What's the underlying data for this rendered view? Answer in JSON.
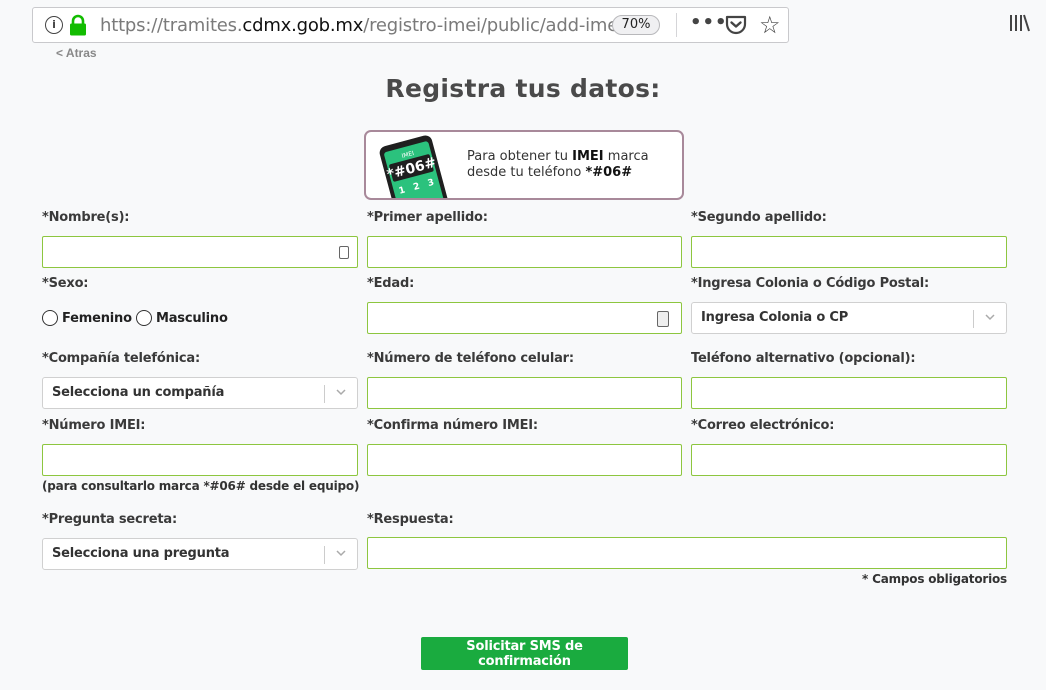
{
  "browser": {
    "url_prefix": "https://tramites.",
    "url_host": "cdmx.gob.mx",
    "url_path": "/registro-imei/public/add-imei",
    "zoom": "70%"
  },
  "page": {
    "back_link": "< Atras",
    "title": "Registra tus datos:"
  },
  "banner": {
    "phone_screen_label": "IMEI",
    "phone_screen_code": "*#06#",
    "keypad": [
      "1",
      "2",
      "3"
    ],
    "text_part1": "Para obtener tu ",
    "text_bold1": "IMEI",
    "text_part2": " marca",
    "text_line2": "desde tu teléfono ",
    "text_bold2": "*#06#"
  },
  "form": {
    "nombre_label": "*Nombre(s):",
    "primer_apellido_label": "*Primer apellido:",
    "segundo_apellido_label": "*Segundo apellido:",
    "sexo_label": "*Sexo:",
    "sexo_options": [
      "Femenino",
      "Masculino"
    ],
    "edad_label": "*Edad:",
    "colonia_label": "*Ingresa Colonia o Código Postal:",
    "colonia_placeholder": "Ingresa Colonia o CP",
    "compania_label": "*Compañía telefónica:",
    "compania_placeholder": "Selecciona un compañía",
    "telefono_label": "*Número de teléfono celular:",
    "telefono_alt_label": "Teléfono alternativo (opcional):",
    "imei_label": "*Número IMEI:",
    "imei_confirm_label": "*Confirma número IMEI:",
    "correo_label": "*Correo electrónico:",
    "imei_hint": "(para consultarlo marca *#06# desde el equipo)",
    "pregunta_label": "*Pregunta secreta:",
    "pregunta_placeholder": "Selecciona una pregunta",
    "respuesta_label": "*Respuesta:",
    "required_note": "* Campos obligatorios",
    "submit_label": "Solicitar SMS de confirmación"
  },
  "colors": {
    "accent_green": "#1aab3f",
    "input_border": "#8dc63f",
    "banner_border": "#a8899a"
  }
}
